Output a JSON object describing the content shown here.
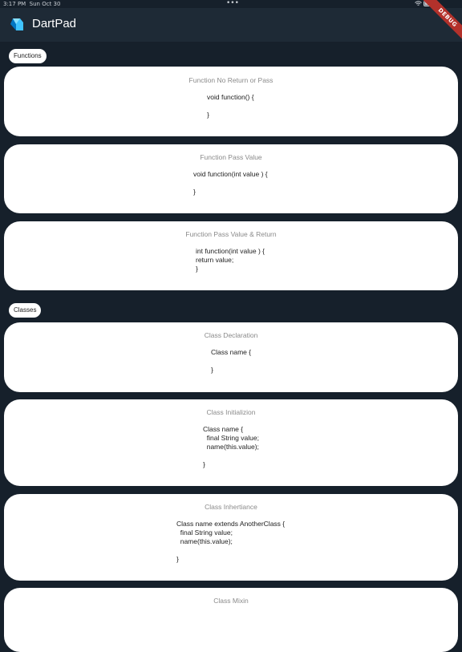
{
  "status": {
    "time": "3:17 PM",
    "date": "Sun Oct 30",
    "dots": "•••",
    "battery": "100%"
  },
  "app": {
    "title": "DartPad",
    "debug_label": "DEBUG"
  },
  "sections": {
    "functions": "Functions",
    "classes": "Classes"
  },
  "cards": [
    {
      "title": "Function No Return or Pass",
      "code": "void function() {\n\n}"
    },
    {
      "title": "Function Pass Value",
      "code": "void function(int value ) {\n\n}"
    },
    {
      "title": "Function Pass Value & Return",
      "code": "int function(int value ) {\nreturn value;\n}"
    },
    {
      "title": "Class Declaration",
      "code": "Class name {\n\n}"
    },
    {
      "title": "Class Initializion",
      "code": "Class name {\n  final String value;\n  name(this.value);\n\n}"
    },
    {
      "title": "Class Inhertiance",
      "code": "Class name extends AnotherClass {\n  final String value;\n  name(this.value);\n\n}"
    },
    {
      "title": "Class Mixin",
      "code": ""
    }
  ],
  "colors": {
    "background": "#16202b",
    "appbar": "#1e2a36",
    "card": "#ffffff",
    "debug": "#b3312b"
  }
}
